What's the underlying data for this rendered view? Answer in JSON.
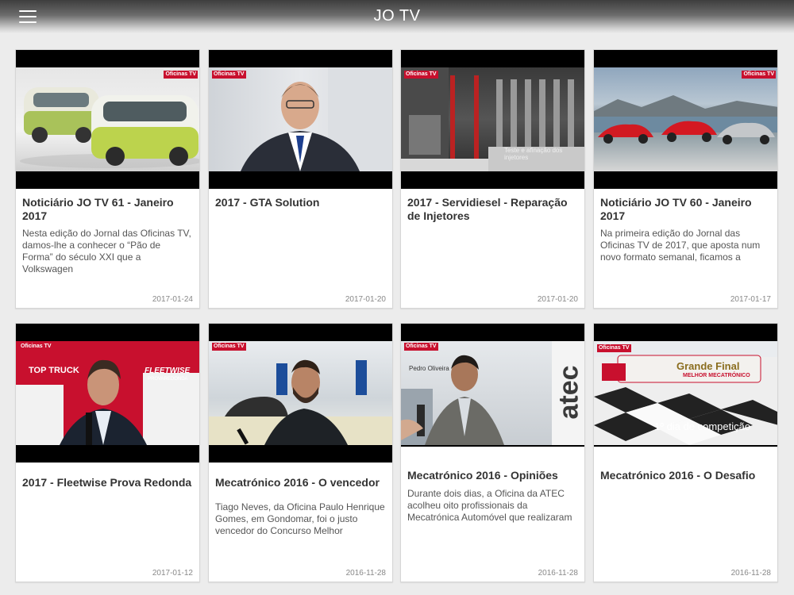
{
  "header": {
    "title": "JO TV",
    "menu_icon": "hamburger-menu-icon"
  },
  "watermark": "Oficinas TV",
  "cards": [
    {
      "title": "Noticiário JO TV 61 - Janeiro 2017",
      "description": "Nesta edição do Jornal das Oficinas TV, damos-lhe a conhecer o “Pão de Forma” do século XXI que a Volkswagen",
      "date": "2017-01-24"
    },
    {
      "title": "2017 - GTA Solution",
      "description": "",
      "date": "2017-01-20"
    },
    {
      "title": "2017 - Servidiesel - Reparação de Injetores",
      "description": "",
      "date": "2017-01-20",
      "overlay": "Teste e afinação dos injetores"
    },
    {
      "title": "Noticiário JO TV 60 - Janeiro 2017",
      "description": "Na primeira edição do Jornal das Oficinas TV de 2017, que aposta num novo formato semanal, ficamos a",
      "date": "2017-01-17"
    },
    {
      "title": "2017 - Fleetwise Prova Redonda",
      "description": "",
      "date": "2017-01-12",
      "banner_1": "TOP TRUCK",
      "banner_2": "FLEETWISE",
      "banner_3": "PROVAREDONDA"
    },
    {
      "title": "Mecatrónico 2016 - O vencedor",
      "description": "Tiago Neves, da Oficina Paulo Henrique Gomes, em Gondomar, foi o justo vencedor do Concurso Melhor",
      "date": "2016-11-28"
    },
    {
      "title": "Mecatrónico 2016 - Opiniões",
      "description": "Durante dois dias, a Oficina da ATEC acolheu oito profissionais da Mecatrónica Automóvel que realizaram",
      "date": "2016-11-28",
      "brand": "atec",
      "caption": "Pedro Oliveira"
    },
    {
      "title": "Mecatrónico 2016 - O Desafio",
      "description": "",
      "date": "2016-11-28",
      "banner_1": "Grande Final",
      "banner_2": "MELHOR MECATRÓNICO",
      "overlay": "1º dia de competição"
    }
  ],
  "colors": {
    "brand_red": "#c8102e",
    "card_bg": "#ffffff",
    "page_bg": "#ececec"
  }
}
